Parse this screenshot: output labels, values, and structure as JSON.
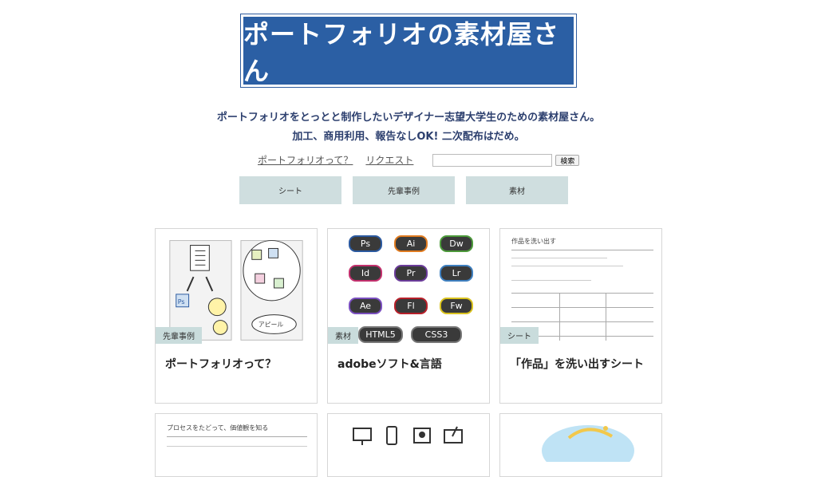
{
  "logo": {
    "text": "ポートフォリオの素材屋さん"
  },
  "tagline": [
    "ポートフォリオをとっとと制作したいデザイナー志望大学生のための素材屋さん。",
    "加工、商用利用、報告なしOK! 二次配布はだめ。"
  ],
  "nav": {
    "links": [
      "ポートフォリオって？",
      "リクエスト"
    ],
    "search_button": "検索"
  },
  "categories": [
    "シート",
    "先輩事例",
    "素材"
  ],
  "cards": [
    {
      "tag": "先輩事例",
      "title": "ポートフォリオって？",
      "thumb_label": "アピール"
    },
    {
      "tag": "素材",
      "title": "adobeソフト&言語"
    },
    {
      "tag": "シート",
      "title": "「作品」を洗い出すシート",
      "sheet_heading": "作品を洗い出す"
    }
  ],
  "adobe_badges": [
    {
      "label": "Ps",
      "color": "#2c5aa0"
    },
    {
      "label": "Ai",
      "color": "#e07b20"
    },
    {
      "label": "Dw",
      "color": "#4c9a3a"
    },
    {
      "label": "Id",
      "color": "#c2306d"
    },
    {
      "label": "Pr",
      "color": "#6b3c9a"
    },
    {
      "label": "Lr",
      "color": "#3e7fbf"
    },
    {
      "label": "Ae",
      "color": "#7a4fbf"
    },
    {
      "label": "Fl",
      "color": "#b8202a"
    },
    {
      "label": "Fw",
      "color": "#d9c21e"
    },
    {
      "label": "HTML5",
      "color": "#777777"
    },
    {
      "label": "CSS3",
      "color": "#777777"
    }
  ],
  "bottom_cards": [
    {
      "heading": "プロセスをたどって、価値観を知る"
    }
  ]
}
